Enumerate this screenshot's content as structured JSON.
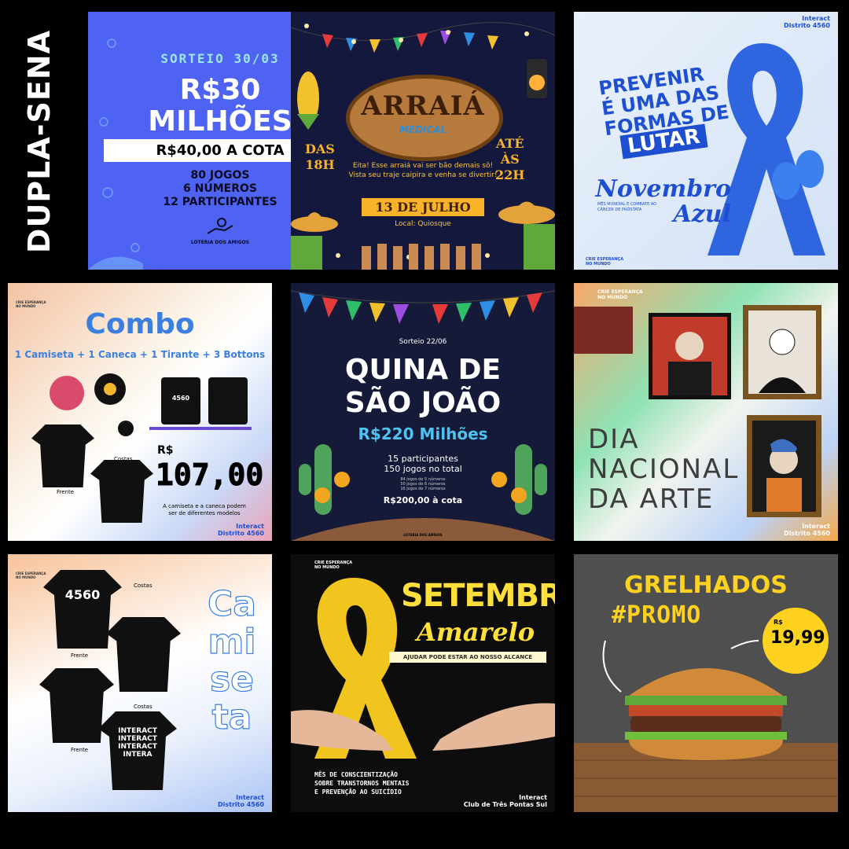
{
  "side_title": "DUPLA-SENA",
  "tile1": {
    "date": "SORTEIO 30/03",
    "amount": "R$30\nMILHÕES",
    "price": "R$40,00 A COTA",
    "details": "80 JOGOS\n6 NÚMEROS\n12 PARTICIPANTES",
    "brand": "LOTERIA DOS AMIGOS"
  },
  "tile2": {
    "title": "ARRAIÁ",
    "brand": "MEDICAL",
    "from": "DAS\n18H",
    "to": "ATÉ\nÀS\n22H",
    "text": "Eita! Esse arraiá vai ser bão demais sô! Vista seu traje caipira e venha se divertir!",
    "date": "13 DE JULHO",
    "location": "Local: Quiosque"
  },
  "tile3": {
    "line1": "PREVENIR\nÉ UMA DAS\nFORMAS DE",
    "line2": "LUTAR",
    "campaign": "Novembro\nAzul",
    "sub": "MÊS MUNDIAL E COMBATE AO CÂNCER DE PRÓSTATA",
    "club": "Interact\nDistrito 4560",
    "logo_text": "CRIE ESPERANÇA\nNO MUNDO"
  },
  "tile4": {
    "title": "Combo",
    "items": "1 Camiseta + 1 Caneca + 1 Tirante + 3 Bottons",
    "currency": "R$",
    "price": "107,00",
    "note": "A camiseta e a caneca podem ser de diferentes modelos",
    "back": "Costas",
    "front": "Frente",
    "mug": "4560",
    "club": "Interact\nDistrito 4560",
    "logo_text": "CRIE ESPERANÇA\nNO MUNDO"
  },
  "tile5": {
    "date": "Sorteio 22/06",
    "title": "QUINA DE\nSÃO JOÃO",
    "amount": "R$220 Milhões",
    "participants": "15 participantes\n150 jogos no total",
    "games": "84 jogos de 5 números\n50 jogos de 6 números\n16 jogos de 7 números",
    "price": "R$200,00 à cota",
    "brand": "LOTERIA DOS AMIGOS"
  },
  "tile6": {
    "title": "DIA\nNACIONAL\nDA ARTE",
    "logo_text": "CRIE ESPERANÇA\nNO MUNDO",
    "club": "Interact\nDistrito 4560"
  },
  "tile7": {
    "title": "Ca\nmi\nse\nta",
    "front1": "Frente",
    "back1": "Costas",
    "front2": "Frente",
    "back2": "Costas",
    "shirt_num": "4560",
    "shirt_print": "INTERACT\nINTERACT\nINTERACT\nINTERA",
    "club": "Interact\nDistrito 4560",
    "logo_text": "CRIE ESPERANÇA\nNO MUNDO"
  },
  "tile8": {
    "title": "SETEMBRO",
    "subtitle": "Amarelo",
    "tagline": "AJUDAR PODE ESTAR AO NOSSO ALCANCE",
    "text": "MÊS DE CONSCIENTIZAÇÃO\nSOBRE TRANSTORNOS MENTAIS\nE PREVENÇÃO AO SUICÍDIO",
    "logo_text": "CRIE ESPERANÇA\nNO MUNDO",
    "club": "Interact\nClub de Três Pontas Sul"
  },
  "tile9": {
    "title": "GRELHADOS",
    "tag": "#PROMO",
    "currency": "R$",
    "price": "19,99"
  },
  "colors": {
    "sena_blue": "#4f63f2",
    "arraia_bg": "#14183d",
    "yellow": "#ffd21f",
    "interact_blue": "#1f4fd1"
  }
}
